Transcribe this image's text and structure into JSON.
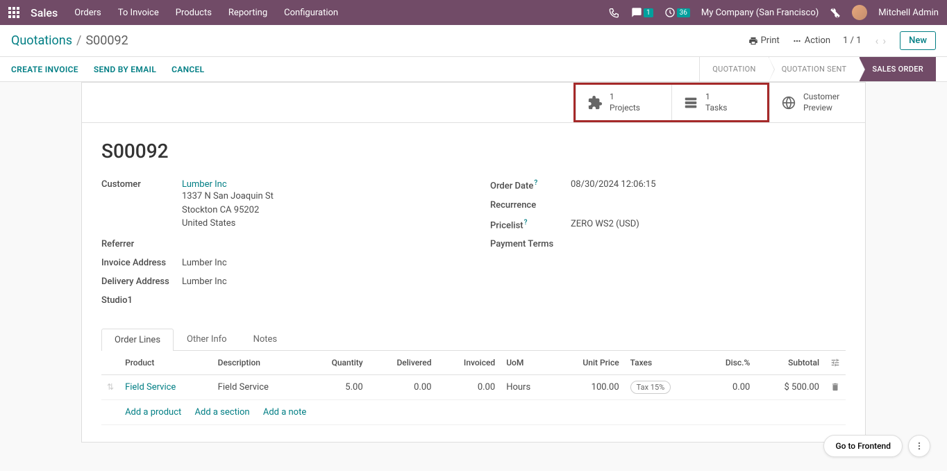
{
  "nav": {
    "app_name": "Sales",
    "menu": [
      "Orders",
      "To Invoice",
      "Products",
      "Reporting",
      "Configuration"
    ],
    "chat_badge": "1",
    "clock_badge": "36",
    "company": "My Company (San Francisco)",
    "user": "Mitchell Admin"
  },
  "breadcrumb": {
    "parent": "Quotations",
    "current": "S00092",
    "print": "Print",
    "action": "Action",
    "pager": "1 / 1",
    "new_btn": "New"
  },
  "actions": {
    "create_invoice": "CREATE INVOICE",
    "send_email": "SEND BY EMAIL",
    "cancel": "CANCEL"
  },
  "status": {
    "quotation": "QUOTATION",
    "quotation_sent": "QUOTATION SENT",
    "sales_order": "SALES ORDER"
  },
  "stats": {
    "projects_count": "1",
    "projects_label": "Projects",
    "tasks_count": "1",
    "tasks_label": "Tasks",
    "preview_label1": "Customer",
    "preview_label2": "Preview"
  },
  "record": {
    "title": "S00092",
    "left": {
      "customer_label": "Customer",
      "customer_name": "Lumber Inc",
      "addr1": "1337 N San Joaquin St",
      "addr2": "Stockton CA 95202",
      "addr3": "United States",
      "referrer_label": "Referrer",
      "referrer_value": "",
      "invoice_addr_label": "Invoice Address",
      "invoice_addr_value": "Lumber Inc",
      "delivery_addr_label": "Delivery Address",
      "delivery_addr_value": "Lumber Inc",
      "studio_label": "Studio1",
      "studio_value": ""
    },
    "right": {
      "order_date_label": "Order Date",
      "order_date_value": "08/30/2024 12:06:15",
      "recurrence_label": "Recurrence",
      "recurrence_value": "",
      "pricelist_label": "Pricelist",
      "pricelist_value": "ZERO WS2 (USD)",
      "payment_terms_label": "Payment Terms",
      "payment_terms_value": ""
    }
  },
  "tabs": {
    "order_lines": "Order Lines",
    "other_info": "Other Info",
    "notes": "Notes"
  },
  "table": {
    "headers": {
      "product": "Product",
      "description": "Description",
      "quantity": "Quantity",
      "delivered": "Delivered",
      "invoiced": "Invoiced",
      "uom": "UoM",
      "unit_price": "Unit Price",
      "taxes": "Taxes",
      "disc": "Disc.%",
      "subtotal": "Subtotal"
    },
    "rows": [
      {
        "product": "Field Service",
        "description": "Field Service",
        "quantity": "5.00",
        "delivered": "0.00",
        "invoiced": "0.00",
        "uom": "Hours",
        "unit_price": "100.00",
        "taxes": "Tax 15%",
        "disc": "0.00",
        "subtotal": "$ 500.00"
      }
    ],
    "add_product": "Add a product",
    "add_section": "Add a section",
    "add_note": "Add a note"
  },
  "float": {
    "goto": "Go to Frontend"
  }
}
